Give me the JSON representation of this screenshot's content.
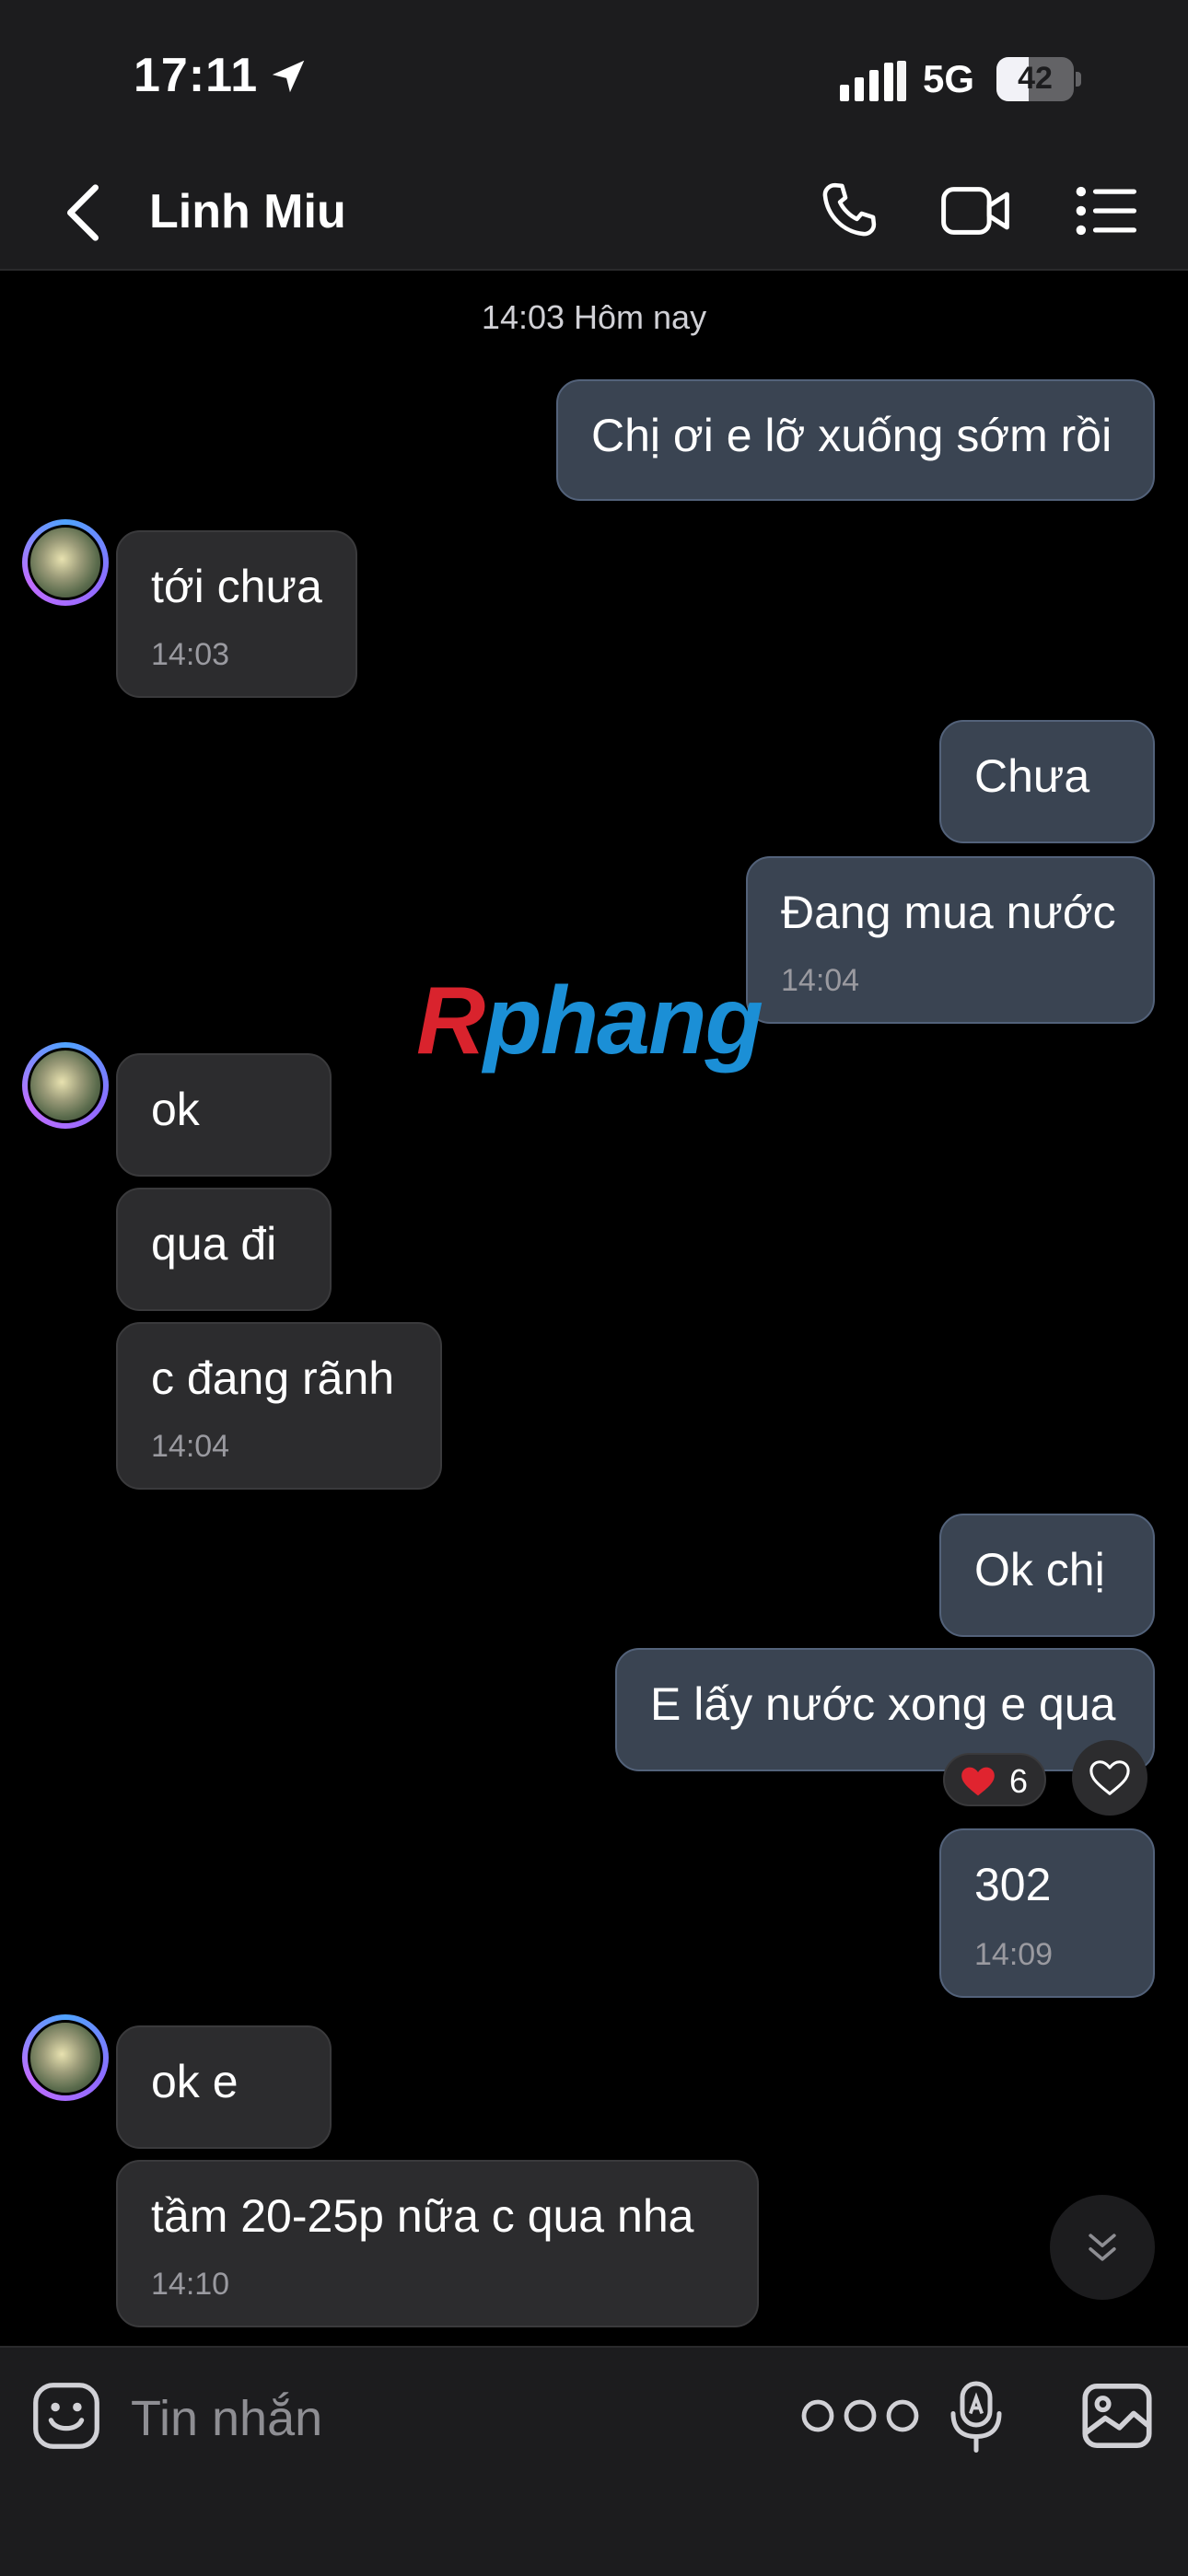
{
  "status_bar": {
    "time": "17:11",
    "network": "5G",
    "battery": "42",
    "battery_percent": 42
  },
  "header": {
    "contact_name": "Linh Miu"
  },
  "chat": {
    "date_separator": "14:03 Hôm nay",
    "messages": [
      {
        "dir": "out",
        "text": "Chị ơi e lỡ xuống sớm rồi",
        "time": ""
      },
      {
        "dir": "in",
        "text": "tới chưa",
        "time": "14:03"
      },
      {
        "dir": "out",
        "text": "Chưa",
        "time": ""
      },
      {
        "dir": "out",
        "text": "Đang mua nước",
        "time": "14:04"
      },
      {
        "dir": "in",
        "text": "ok",
        "time": ""
      },
      {
        "dir": "in",
        "text": "qua đi",
        "time": ""
      },
      {
        "dir": "in",
        "text": "c đang rãnh",
        "time": "14:04"
      },
      {
        "dir": "out",
        "text": "Ok chị",
        "time": ""
      },
      {
        "dir": "out",
        "text": "E lấy nước xong e qua",
        "time": ""
      },
      {
        "dir": "out",
        "text": "302",
        "time": "14:09"
      },
      {
        "dir": "in",
        "text": "ok e",
        "time": ""
      },
      {
        "dir": "in",
        "text": "tầm 20-25p nữa c qua nha",
        "time": "14:10"
      }
    ],
    "reaction": {
      "icon": "heart-icon",
      "count": "6",
      "color": "#e0242f"
    }
  },
  "watermark": {
    "first": "R",
    "rest": "phang"
  },
  "composer": {
    "placeholder": "Tin nhắn"
  },
  "colors": {
    "outgoing_bubble": "#3a4452",
    "incoming_bubble": "#2c2c2e",
    "bar_background": "#1c1c1e"
  }
}
